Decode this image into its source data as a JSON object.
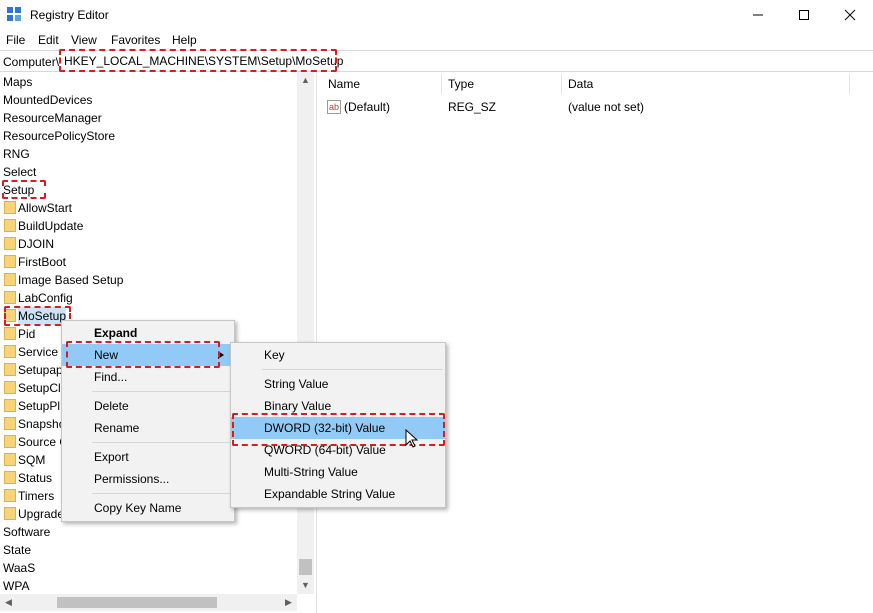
{
  "window": {
    "title": "Registry Editor"
  },
  "menu": [
    "File",
    "Edit",
    "View",
    "Favorites",
    "Help"
  ],
  "address": {
    "prefix": "Computer\\",
    "path": "HKEY_LOCAL_MACHINE\\SYSTEM\\Setup\\MoSetup"
  },
  "tree": {
    "top_items": [
      "Maps",
      "MountedDevices",
      "ResourceManager",
      "ResourcePolicyStore",
      "RNG",
      "Select",
      "Setup"
    ],
    "setup_children": [
      "AllowStart",
      "BuildUpdate",
      "DJOIN",
      "FirstBoot",
      "Image Based Setup",
      "LabConfig",
      "MoSetup",
      "Pid",
      "Service",
      "Setupap",
      "SetupCl",
      "SetupPl",
      "Snapsho",
      "Source O",
      "SQM",
      "Status",
      "Timers",
      "Upgrade"
    ],
    "bottom_items": [
      "Software",
      "State",
      "WaaS",
      "WPA"
    ]
  },
  "columns": {
    "name": "Name",
    "type": "Type",
    "data": "Data"
  },
  "values": [
    {
      "icon": "ab",
      "name": "(Default)",
      "type": "REG_SZ",
      "data": "(value not set)"
    }
  ],
  "context_menu": {
    "expand": "Expand",
    "new": "New",
    "find": "Find...",
    "delete": "Delete",
    "rename": "Rename",
    "export": "Export",
    "permissions": "Permissions...",
    "copy_key_name": "Copy Key Name"
  },
  "submenu": {
    "key": "Key",
    "string": "String Value",
    "binary": "Binary Value",
    "dword": "DWORD (32-bit) Value",
    "qword": "QWORD (64-bit) Value",
    "multi": "Multi-String Value",
    "expandable": "Expandable String Value"
  }
}
